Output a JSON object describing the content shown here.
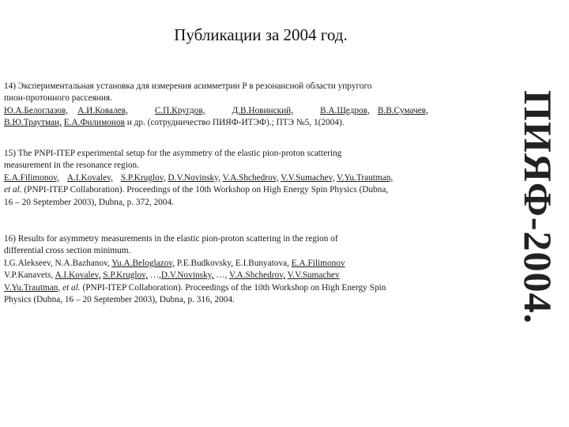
{
  "header": {
    "title": "Публикации за 2004 год.",
    "side_logo": "ПИЯФ-2004."
  },
  "pub14": {
    "line1": "14) Экспериментальная   установка   для измерения асимметрии Р в  резонансной   области упругого",
    "line2": "пион-протонного рассеяния.",
    "a1": "Ю.А.Белоглазов,",
    "a2": "А.И.Ковалев,",
    "a3": "С.П.Кругдов,",
    "a4": "Д.В.Новинский,",
    "a5": "В.А.Щедров,",
    "a6": "В.В.Сумачев,",
    "a7": "В.Ю.Траутман,",
    "a8": "Е.А.Филимонов",
    "tail": " и др. (сотрудничество ПИЯФ-ИТЭФ).;  ПТЭ №5, 1(2004)."
  },
  "pub15": {
    "line1": " 15) The  PNPI-ITEP  experimental setup for the asymmetry of the elastic  pion-proton  scattering",
    "line2": "measurement in the resonance region.",
    "a1": "E.A.Filimonov,",
    "a2": "A.I.Kovalev,",
    "a3": "S.P.Kruglov,",
    "a4": "D.V.Novinsky,",
    "a5": "V.A.Shchedrov,",
    "a6": "V.V.Sumachev,",
    "a7": "V.Yu.Trautman,",
    "etal": "et al.",
    "line4": " (PNPI-ITEP Collaboration). Proceedings of the  10th  Workshop  on  High  Energy  Spin  Physics (Dubna,",
    "line5": "16 – 20 September 2003), Dubna, p. 372, 2004."
  },
  "pub16": {
    "line1": "16) Results  for  asymmetry  measurements  in  the elastic pion-proton scattering  in the region of",
    "line2": "differential cross section minimum.",
    "l3a": "I.G.Alekseev, N.A.Bazhanov, ",
    "l3u1": "Yu.A.Beloglazov,",
    "l3b": " P.E.Budkovsky, E.I.Bunyatova, ",
    "l3u2": "E.A.Filimonov",
    "l4a": "V.P.Kanavets, ",
    "l4u1": "A.I.Kovalev,",
    "l4b": " ",
    "l4u2": "S.P.Kruglov,",
    "l4c": " …,",
    "l4u3": "D.V.Novinsky,",
    "l4d": " …, ",
    "l4u4": "V.A.Shchedrov,",
    "l4e": " ",
    "l4u5": "V.V.Sumachev",
    "l5u": "V.Yu.Trautman,",
    "l5etal": " et al.",
    "l5rest": "  (PNPI-ITEP Collaboration).  Proceedings of the 10th  Workshop  on  High  Energy  Spin",
    "line6": "Physics (Dubna,  16 – 20 September 2003), Dubna, p. 316, 2004."
  }
}
